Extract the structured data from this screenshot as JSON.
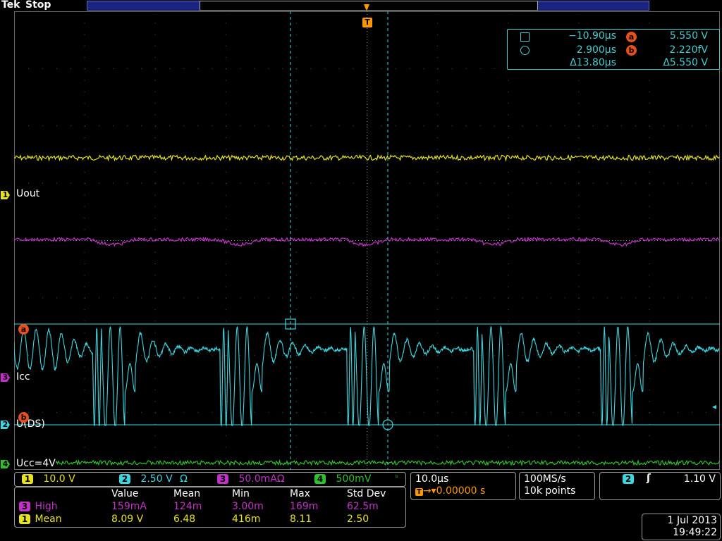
{
  "app": {
    "brand": "Tek",
    "status": "Stop"
  },
  "trigger_marker": "T",
  "cursors": {
    "cursor1_time": "−10.90µs",
    "cursor2_time": "2.900µs",
    "delta_time": "Δ13.80µs",
    "a_label": "a",
    "b_label": "b",
    "a_value": "5.550 V",
    "b_value": "2.220fV",
    "delta_value": "Δ5.550 V"
  },
  "channels": [
    {
      "num": "1",
      "name": "Uout",
      "scale": "10.0 V",
      "color": "#e6e21c"
    },
    {
      "num": "2",
      "name": "U(DS)",
      "scale": "2.50 V",
      "unit_icon": "Ω",
      "color": "#3cd6e0"
    },
    {
      "num": "3",
      "name": "Icc",
      "scale": "50.0mAΩ",
      "color": "#c232c8"
    },
    {
      "num": "4",
      "name": "Ucc=4V",
      "scale": "500mV",
      "color": "#2ec02e"
    }
  ],
  "marker_labels": {
    "a": "a",
    "b": "b"
  },
  "bandwidth_icon": "b-limit-icon",
  "timebase": {
    "scale": "10.0µs",
    "trigger_pos": "0.00000 s"
  },
  "acquisition": {
    "rate": "100MS/s",
    "points": "10k points"
  },
  "trigger": {
    "source": "2",
    "slope_icon": "rising-edge-icon",
    "level": "1.10 V"
  },
  "measurements": {
    "headers": [
      "Value",
      "Mean",
      "Min",
      "Max",
      "Std Dev"
    ],
    "rows": [
      {
        "ch": "3",
        "name": "High",
        "color": "#c232c8",
        "values": [
          "159mA",
          "124m",
          "3.00m",
          "169m",
          "62.5m"
        ]
      },
      {
        "ch": "1",
        "name": "Mean",
        "color": "#e6e21c",
        "values": [
          "8.09 V",
          "6.48",
          "416m",
          "8.11",
          "2.50"
        ]
      }
    ]
  },
  "datetime": {
    "date": "1 Jul  2013",
    "time": "19:49:22"
  }
}
